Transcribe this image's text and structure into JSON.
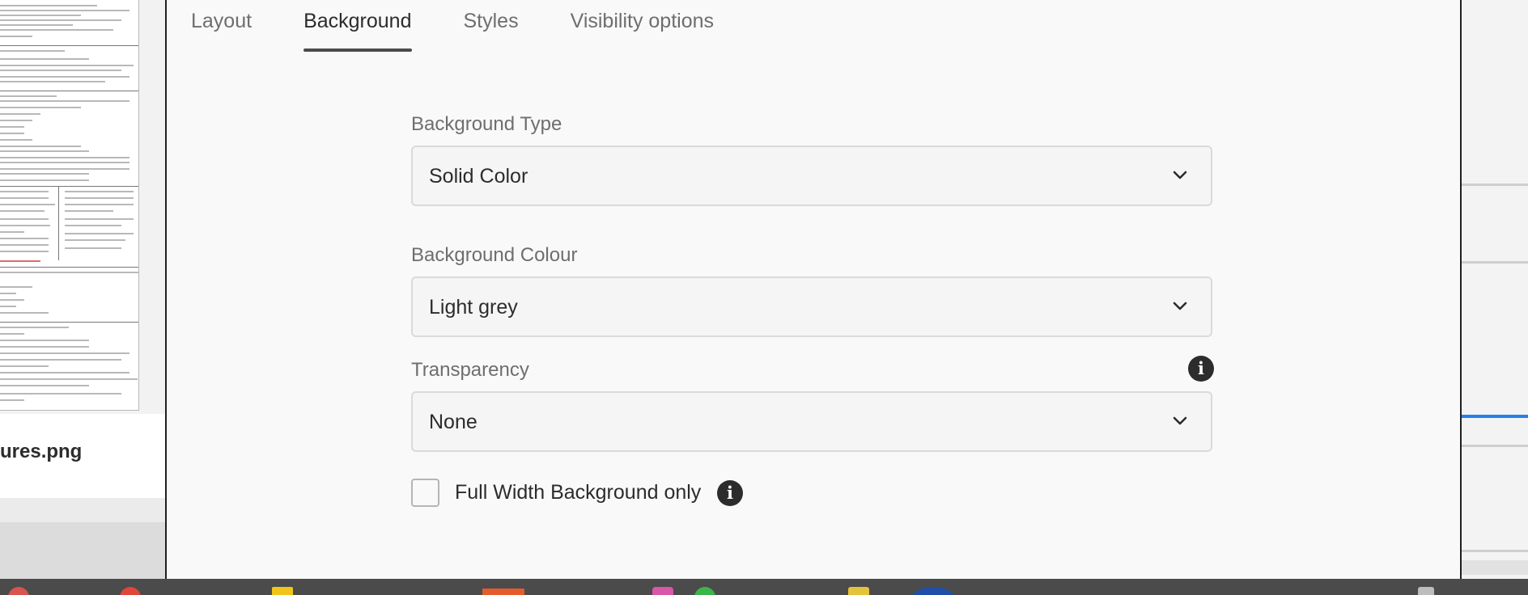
{
  "background_window": {
    "file_name": "ures.png"
  },
  "dialog": {
    "tabs": [
      {
        "label": "Layout",
        "active": false
      },
      {
        "label": "Background",
        "active": true
      },
      {
        "label": "Styles",
        "active": false
      },
      {
        "label": "Visibility options",
        "active": false
      }
    ],
    "background_type": {
      "label": "Background Type",
      "value": "Solid Color",
      "icon": "chevron-down-icon"
    },
    "background_colour": {
      "label": "Background Colour",
      "value": "Light grey",
      "icon": "chevron-down-icon"
    },
    "transparency": {
      "label": "Transparency",
      "value": "None",
      "icon": "chevron-down-icon",
      "info_icon": "info-icon"
    },
    "full_width": {
      "label": "Full Width Background only",
      "checked": false,
      "info_icon": "info-icon"
    }
  },
  "colors": {
    "accent": "#2680eb",
    "tab_underline": "#4b4b4b",
    "text_primary": "#2c2c2c",
    "text_secondary": "#6e6e6e"
  }
}
